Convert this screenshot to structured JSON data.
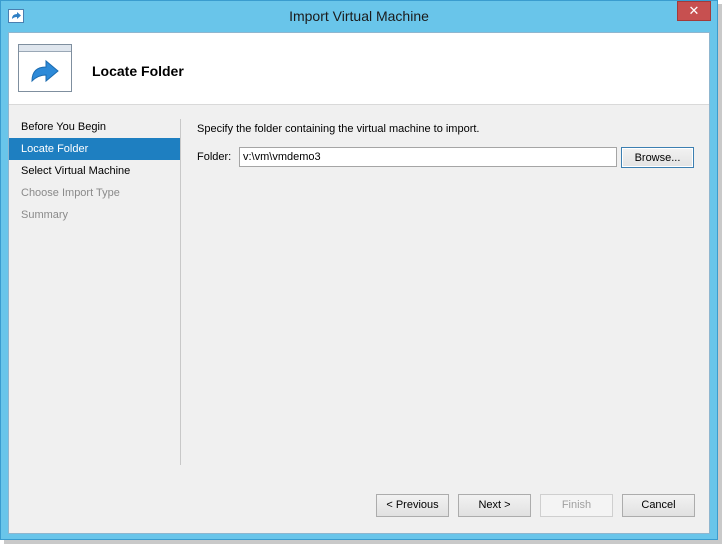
{
  "window": {
    "title": "Import Virtual Machine",
    "close_glyph": "✕"
  },
  "header": {
    "title": "Locate Folder",
    "icon": "import-arrow-icon"
  },
  "nav": {
    "items": [
      {
        "label": "Before You Begin",
        "state": "normal"
      },
      {
        "label": "Locate Folder",
        "state": "selected"
      },
      {
        "label": "Select Virtual Machine",
        "state": "normal"
      },
      {
        "label": "Choose Import Type",
        "state": "disabled"
      },
      {
        "label": "Summary",
        "state": "disabled"
      }
    ]
  },
  "main": {
    "instruction": "Specify the folder containing the virtual machine to import.",
    "folder_label": "Folder:",
    "folder_value": "v:\\vm\\vmdemo3",
    "browse_label": "Browse..."
  },
  "footer": {
    "previous_label": "< Previous",
    "next_label": "Next >",
    "finish_label": "Finish",
    "cancel_label": "Cancel"
  },
  "colors": {
    "title_bar": "#69c5ea",
    "selection": "#1e7fc1",
    "close_button": "#c75050"
  }
}
